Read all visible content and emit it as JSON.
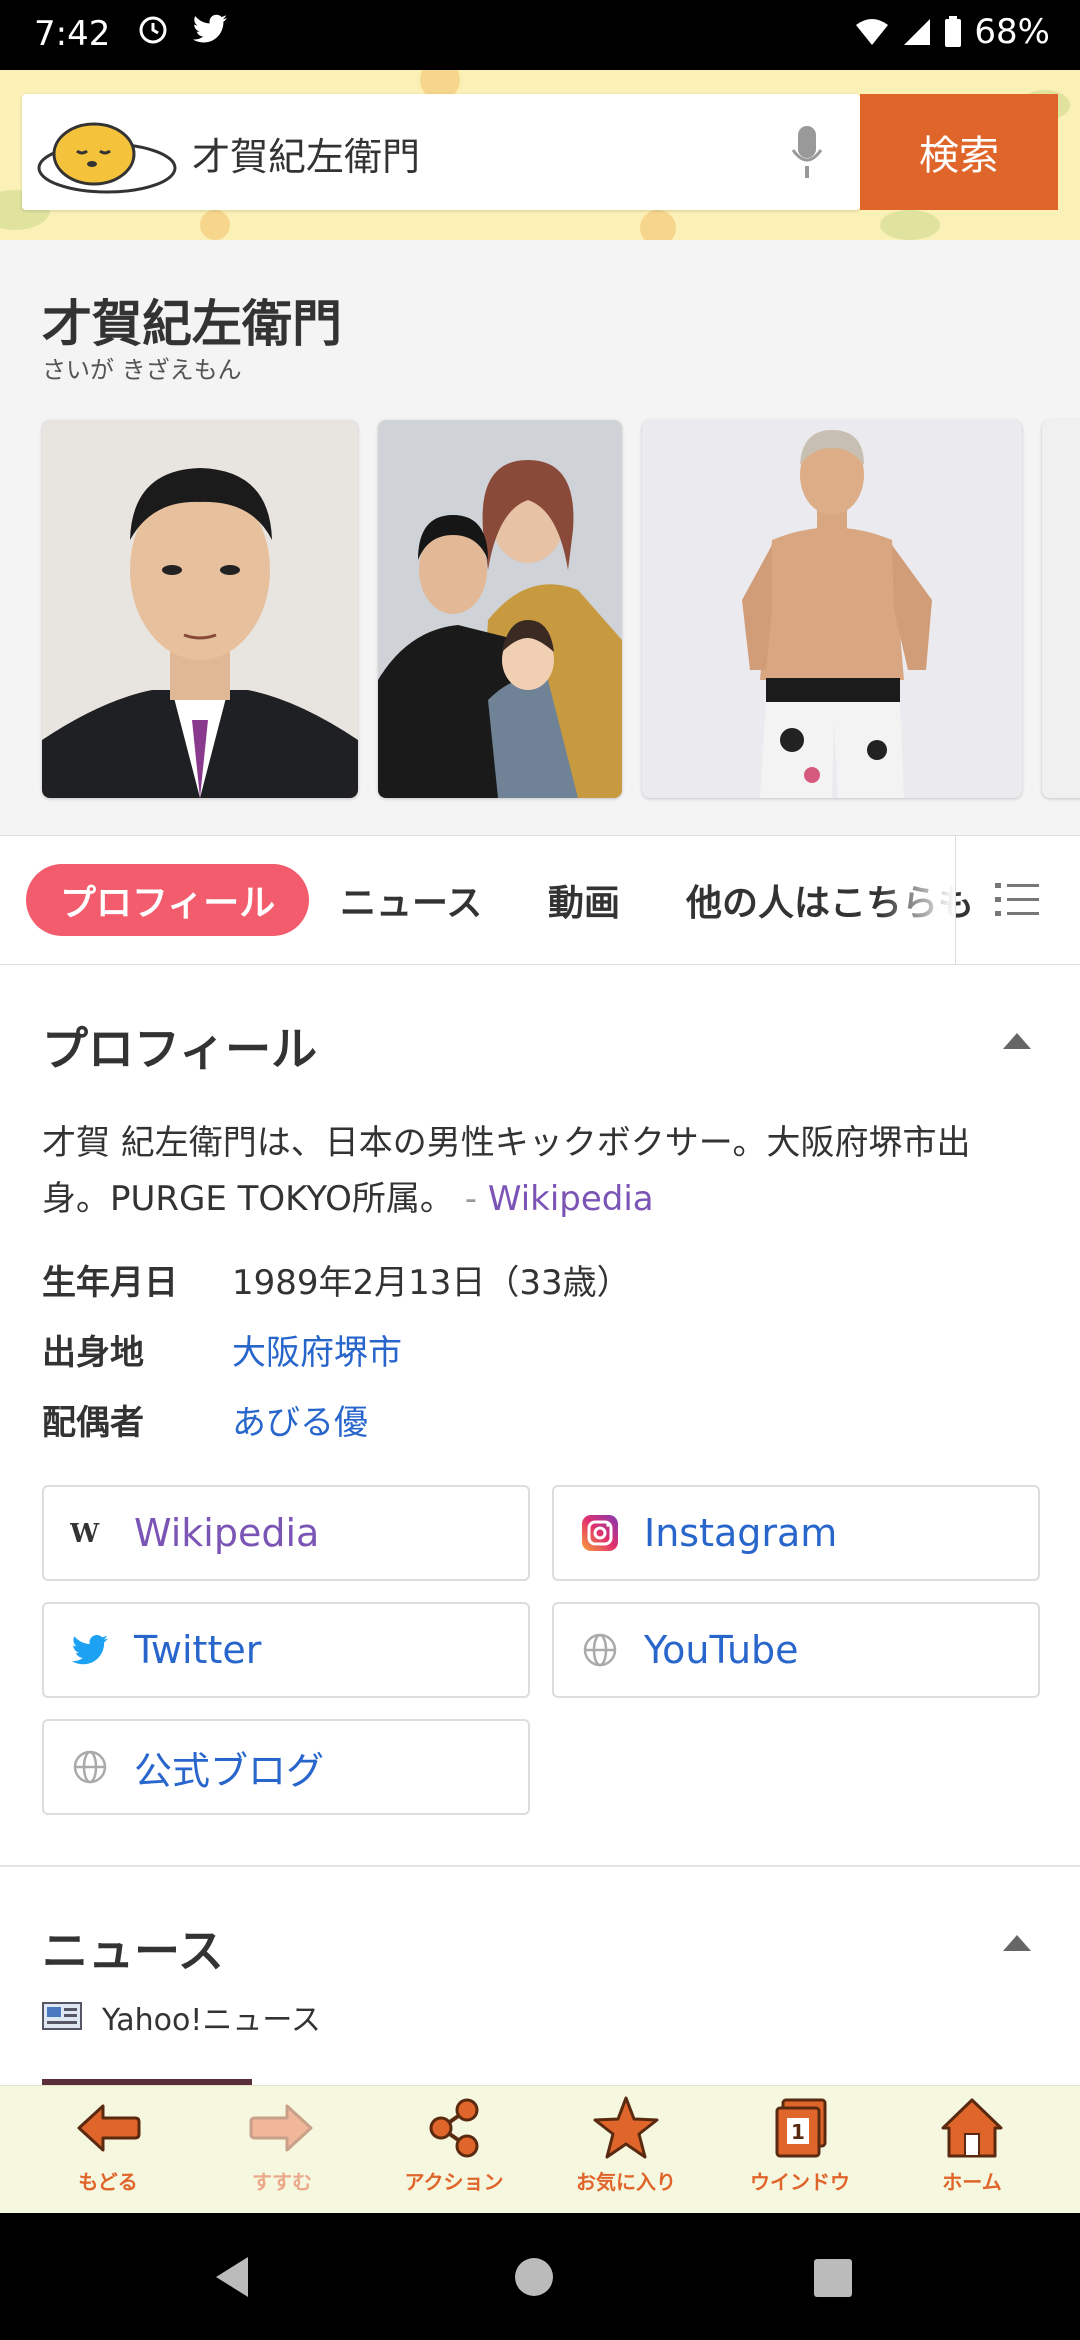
{
  "status_bar": {
    "time": "7:42",
    "battery": "68%"
  },
  "search": {
    "query": "才賀紀左衛門",
    "button_label": "検索"
  },
  "entity": {
    "name": "才賀紀左衛門",
    "reading": "さいが きざえもん"
  },
  "tabs": [
    "プロフィール",
    "ニュース",
    "動画",
    "他の人はこちらも"
  ],
  "profile": {
    "title": "プロフィール",
    "description": "才賀 紀左衛門は、日本の男性キックボクサー。大阪府堺市出身。PURGE TOKYO所属。",
    "description_source": "Wikipedia",
    "facts": [
      {
        "label": "生年月日",
        "value": "1989年2月13日（33歳）"
      },
      {
        "label": "出身地",
        "value": "大阪府堺市"
      },
      {
        "label": "配偶者",
        "value": "あびる優"
      }
    ],
    "links": [
      {
        "label": "Wikipedia",
        "icon": "wikipedia-icon"
      },
      {
        "label": "Instagram",
        "icon": "instagram-icon"
      },
      {
        "label": "Twitter",
        "icon": "twitter-icon"
      },
      {
        "label": "YouTube",
        "icon": "globe-icon"
      },
      {
        "label": "公式ブログ",
        "icon": "globe-icon"
      }
    ]
  },
  "news": {
    "title": "ニュース",
    "source": "Yahoo!ニュース"
  },
  "bottom_nav": [
    {
      "label": "もどる",
      "icon": "back-arrow-icon"
    },
    {
      "label": "すすむ",
      "icon": "forward-arrow-icon"
    },
    {
      "label": "アクション",
      "icon": "share-icon"
    },
    {
      "label": "お気に入り",
      "icon": "star-icon"
    },
    {
      "label": "ウインドウ",
      "icon": "window-icon",
      "badge": "1"
    },
    {
      "label": "ホーム",
      "icon": "home-icon"
    }
  ],
  "colors": {
    "accent": "#e0652a",
    "tab_active": "#f25c6c",
    "link": "#2866cc",
    "wiki_link": "#7b55b5"
  }
}
